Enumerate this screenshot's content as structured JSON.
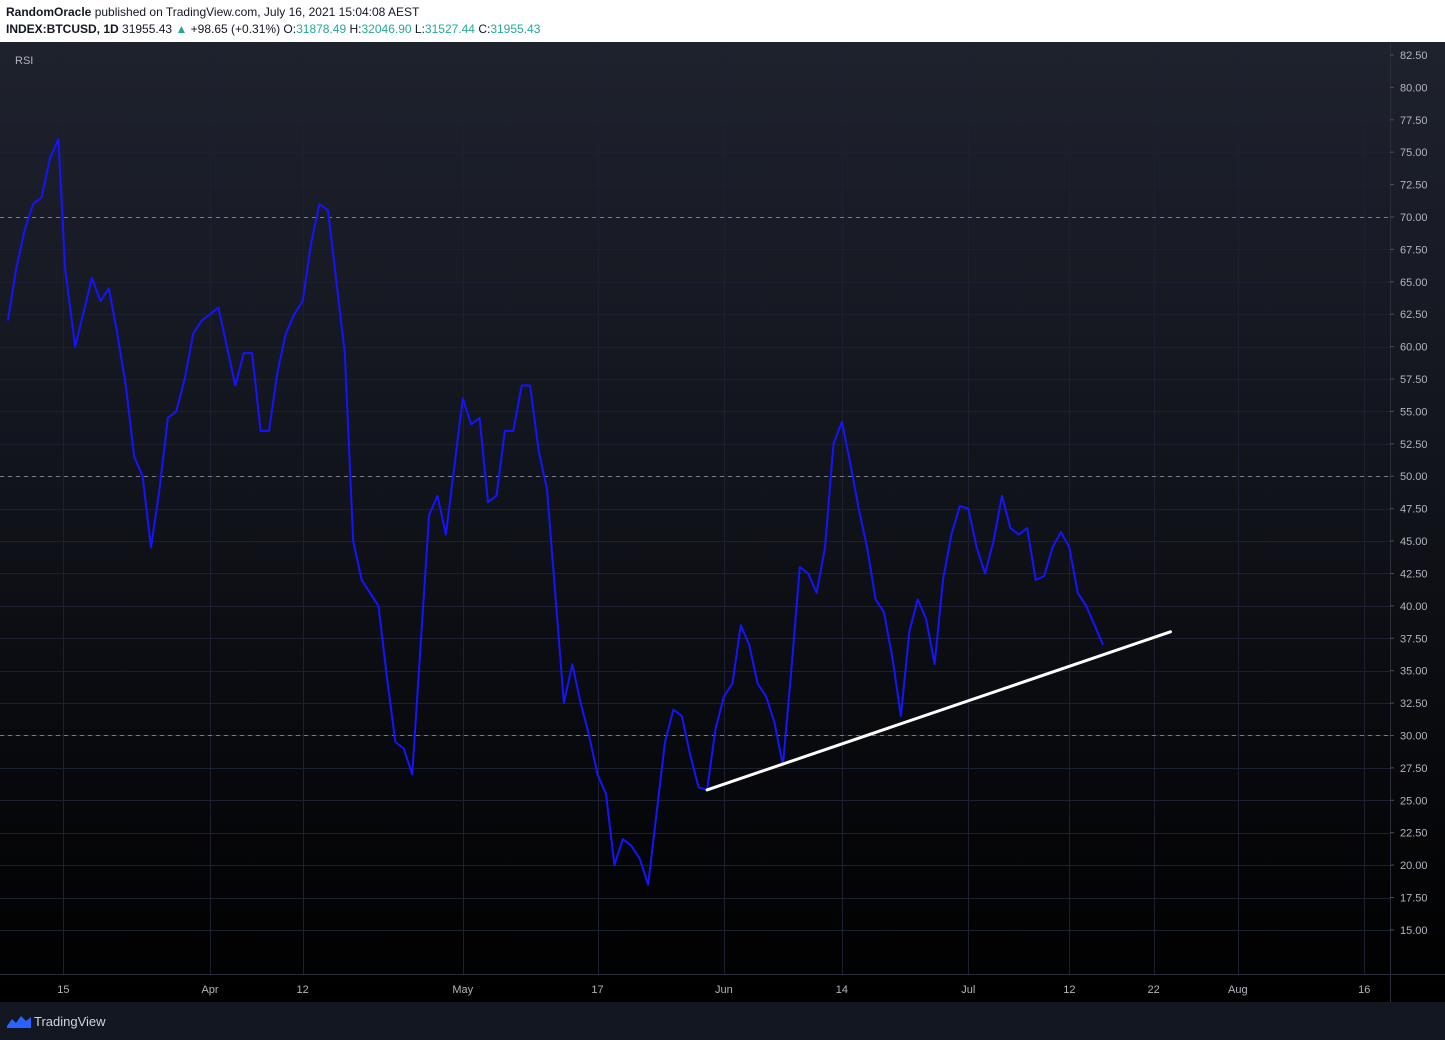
{
  "header": {
    "author": "RandomOracle",
    "published_text": "published on TradingView.com, July 16, 2021 15:04:08 AEST",
    "symbol": "INDEX:BTCUSD, 1D",
    "price": "31955.43",
    "change": "+98.65 (+0.31%)",
    "open_label": "O:",
    "open_value": "31878.49",
    "high_label": "H:",
    "high_value": "32046.90",
    "low_label": "L:",
    "low_value": "31527.44",
    "close_label": "C:",
    "close_value": "31955.43"
  },
  "indicator_label": "RSI",
  "footer": {
    "brand": "TradingView"
  },
  "colors": {
    "rsi_line": "#1414ff",
    "trendline": "#ffffff",
    "level_line": "#787b86",
    "change_up": "#26a69a"
  },
  "chart_data": {
    "type": "line",
    "series": [
      {
        "values": [
          [
            0,
            62
          ],
          [
            0.5,
            66
          ],
          [
            1,
            69
          ],
          [
            1.5,
            71
          ],
          [
            2,
            71.5
          ],
          [
            2.5,
            74.5
          ],
          [
            3,
            76
          ],
          [
            3.4,
            66
          ],
          [
            4,
            60
          ],
          [
            5,
            65.3
          ],
          [
            5.5,
            63.5
          ],
          [
            6,
            64.5
          ],
          [
            6.5,
            61
          ],
          [
            7,
            57
          ],
          [
            7.5,
            51.5
          ],
          [
            8,
            50
          ],
          [
            8.5,
            44.5
          ],
          [
            9,
            49
          ],
          [
            9.5,
            54.5
          ],
          [
            10,
            55
          ],
          [
            10.5,
            57.5
          ],
          [
            11,
            61
          ],
          [
            11.5,
            62
          ],
          [
            12,
            62.5
          ],
          [
            12.5,
            63
          ],
          [
            13,
            60
          ],
          [
            13.5,
            57
          ],
          [
            14,
            59.5
          ],
          [
            14.5,
            59.5
          ],
          [
            15,
            53.5
          ],
          [
            15.5,
            53.5
          ],
          [
            16,
            58
          ],
          [
            16.5,
            61
          ],
          [
            17,
            62.5
          ],
          [
            17.5,
            63.5
          ],
          [
            18,
            68
          ],
          [
            18.5,
            71
          ],
          [
            19,
            70.5
          ],
          [
            19.5,
            65
          ],
          [
            20,
            59.5
          ],
          [
            20.5,
            45
          ],
          [
            21,
            42
          ],
          [
            21.5,
            41
          ],
          [
            22,
            40
          ],
          [
            22.5,
            34.5
          ],
          [
            23,
            29.5
          ],
          [
            23.5,
            29
          ],
          [
            24,
            27
          ],
          [
            25,
            47
          ],
          [
            25.5,
            48.5
          ],
          [
            26,
            45.5
          ],
          [
            27,
            56
          ],
          [
            27.5,
            54
          ],
          [
            28,
            54.5
          ],
          [
            28.5,
            48
          ],
          [
            29,
            48.5
          ],
          [
            29.5,
            53.5
          ],
          [
            30,
            53.5
          ],
          [
            30.5,
            57
          ],
          [
            31,
            57
          ],
          [
            31.5,
            52
          ],
          [
            32,
            49
          ],
          [
            33,
            32.5
          ],
          [
            33.5,
            35.5
          ],
          [
            34,
            32.5
          ],
          [
            34.5,
            30
          ],
          [
            35,
            27
          ],
          [
            35.5,
            25.5
          ],
          [
            36,
            20
          ],
          [
            36.5,
            22
          ],
          [
            37,
            21.5
          ],
          [
            37.5,
            20.5
          ],
          [
            38,
            18.5
          ],
          [
            39,
            29.5
          ],
          [
            39.5,
            32
          ],
          [
            40,
            31.5
          ],
          [
            40.5,
            28.5
          ],
          [
            41,
            26
          ],
          [
            41.5,
            25.8
          ],
          [
            42,
            30.5
          ],
          [
            42.5,
            33
          ],
          [
            43,
            34
          ],
          [
            43.5,
            38.5
          ],
          [
            44,
            37
          ],
          [
            44.5,
            34
          ],
          [
            45,
            33
          ],
          [
            45.5,
            31
          ],
          [
            46,
            27.7
          ],
          [
            46.5,
            35
          ],
          [
            47,
            43
          ],
          [
            47.5,
            42.5
          ],
          [
            48,
            41
          ],
          [
            48.5,
            44.5
          ],
          [
            49,
            52.5
          ],
          [
            49.5,
            54.2
          ],
          [
            50,
            51
          ],
          [
            50.5,
            47.5
          ],
          [
            51,
            44.5
          ],
          [
            51.5,
            40.5
          ],
          [
            52,
            39.5
          ],
          [
            52.5,
            36
          ],
          [
            53,
            31.5
          ],
          [
            53.5,
            38
          ],
          [
            54,
            40.5
          ],
          [
            54.5,
            39
          ],
          [
            55,
            35.5
          ],
          [
            55.5,
            42
          ],
          [
            56,
            45.5
          ],
          [
            56.5,
            47.7
          ],
          [
            57,
            47.5
          ],
          [
            57.5,
            44.5
          ],
          [
            58,
            42.5
          ],
          [
            58.5,
            45
          ],
          [
            59,
            48.5
          ],
          [
            59.5,
            46
          ],
          [
            60,
            45.5
          ],
          [
            60.5,
            46
          ],
          [
            61,
            42
          ],
          [
            61.5,
            42.3
          ],
          [
            62,
            44.5
          ],
          [
            62.5,
            45.7
          ],
          [
            63,
            44.5
          ],
          [
            63.5,
            41
          ],
          [
            64,
            40
          ],
          [
            64.5,
            38.5
          ],
          [
            65,
            37
          ]
        ]
      }
    ],
    "trendline": [
      [
        41.5,
        25.8
      ],
      [
        69,
        38
      ]
    ],
    "levels": [
      70,
      50,
      30
    ],
    "x_tick_labels": [
      "15",
      "Apr",
      "12",
      "May",
      "17",
      "Jun",
      "14",
      "Jul",
      "12",
      "22",
      "Aug",
      "16"
    ],
    "x_tick_positions": [
      3.3,
      12,
      17.5,
      27,
      35,
      42.5,
      49.5,
      57,
      63,
      68,
      73,
      80.5
    ],
    "x_range": [
      0,
      82
    ],
    "y_tick_labels": [
      "82.50",
      "80.00",
      "77.50",
      "75.00",
      "72.50",
      "70.00",
      "67.50",
      "65.00",
      "62.50",
      "60.00",
      "57.50",
      "55.00",
      "52.50",
      "50.00",
      "47.50",
      "45.00",
      "42.50",
      "40.00",
      "37.50",
      "35.00",
      "32.50",
      "30.00",
      "27.50",
      "25.00",
      "22.50",
      "20.00",
      "17.50",
      "15.00"
    ],
    "ylim": [
      11.6,
      83.5
    ],
    "grid": true
  }
}
